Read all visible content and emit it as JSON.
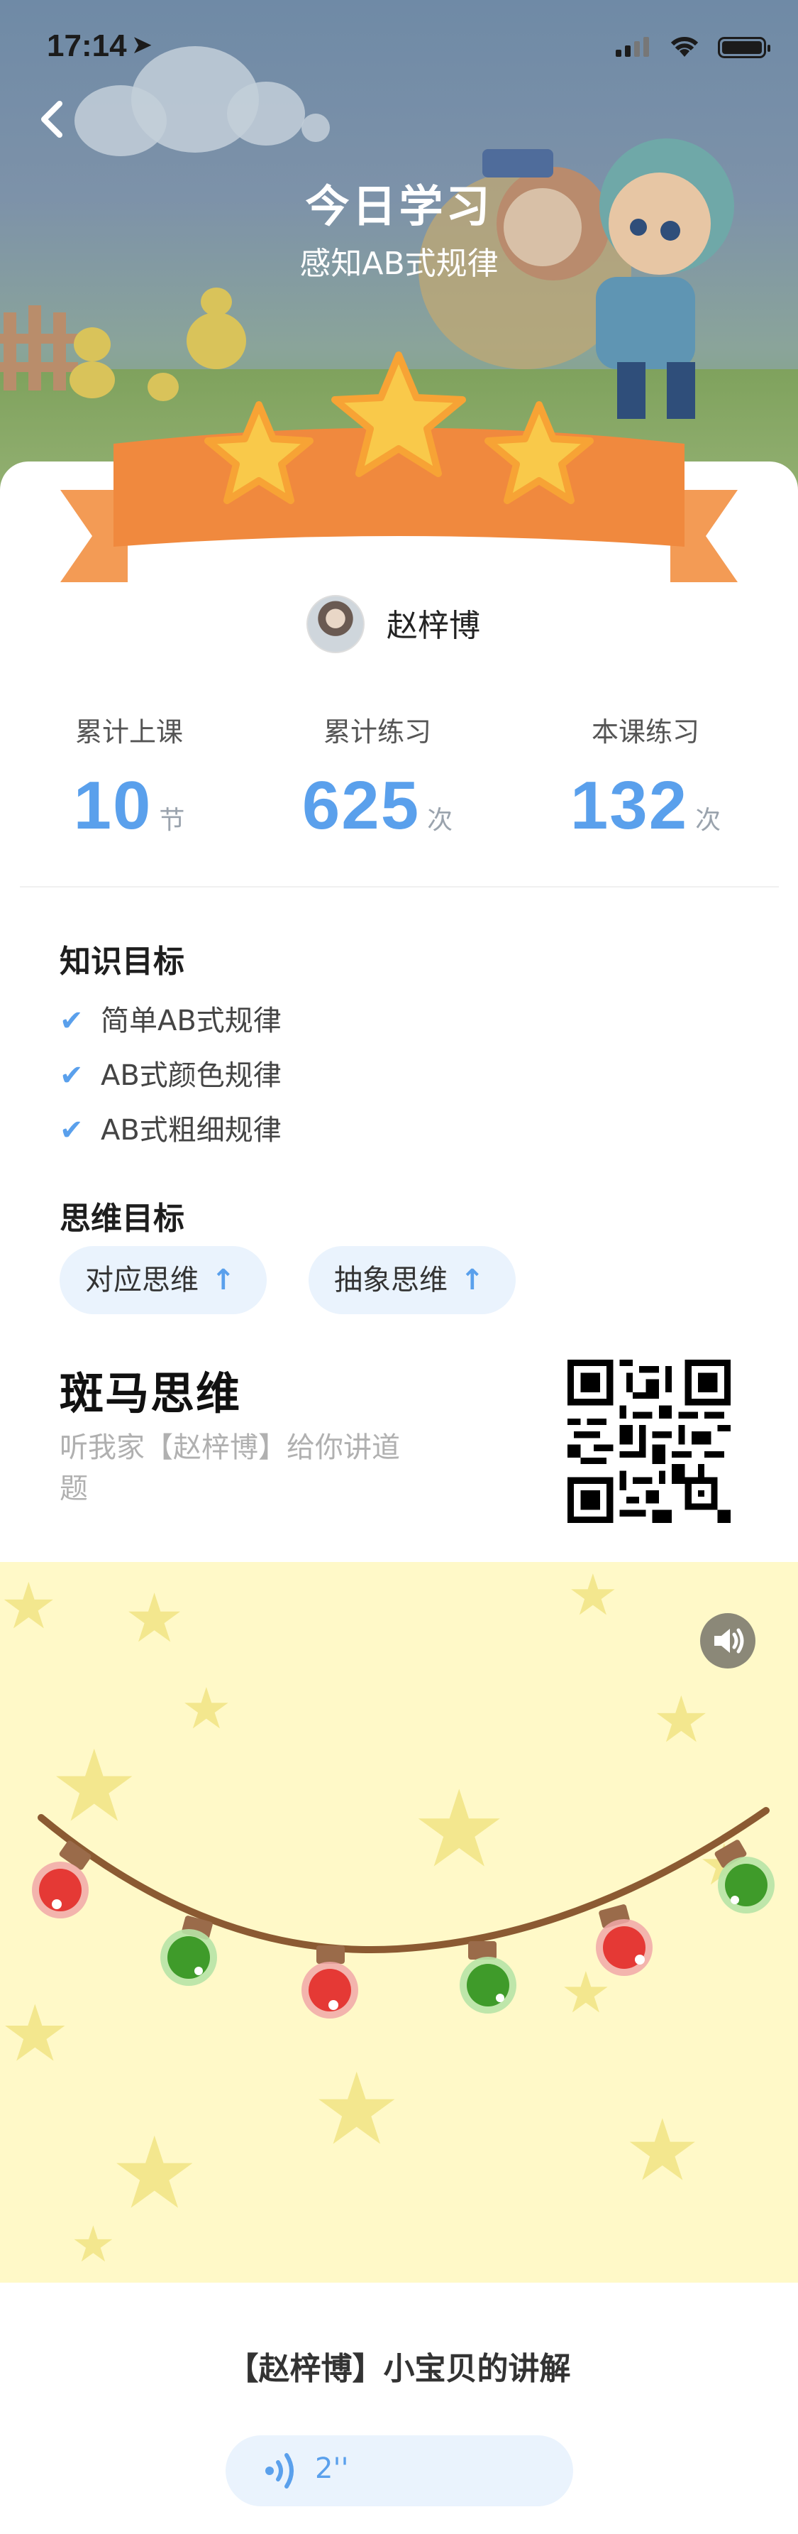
{
  "status_bar": {
    "time": "17:14"
  },
  "header": {
    "title": "今日学习",
    "subtitle": "感知AB式规律"
  },
  "user": {
    "name": "赵梓博"
  },
  "stats": [
    {
      "label": "累计上课",
      "value": "10",
      "unit": "节"
    },
    {
      "label": "累计练习",
      "value": "625",
      "unit": "次"
    },
    {
      "label": "本课练习",
      "value": "132",
      "unit": "次"
    }
  ],
  "knowledge": {
    "title": "知识目标",
    "items": [
      "简单AB式规律",
      "AB式颜色规律",
      "AB式粗细规律"
    ]
  },
  "thinking": {
    "title": "思维目标",
    "tags": [
      "对应思维",
      "抽象思维"
    ]
  },
  "brand": {
    "name": "斑马思维",
    "desc": "听我家【赵梓博】给你讲道题"
  },
  "explanation": {
    "title": "【赵梓博】小宝贝的讲解",
    "duration": "2''"
  },
  "colors": {
    "accent": "#5aa0ec",
    "ribbon": "#f0893e",
    "star": "#f9d64a",
    "stage": "#fff9c8"
  }
}
